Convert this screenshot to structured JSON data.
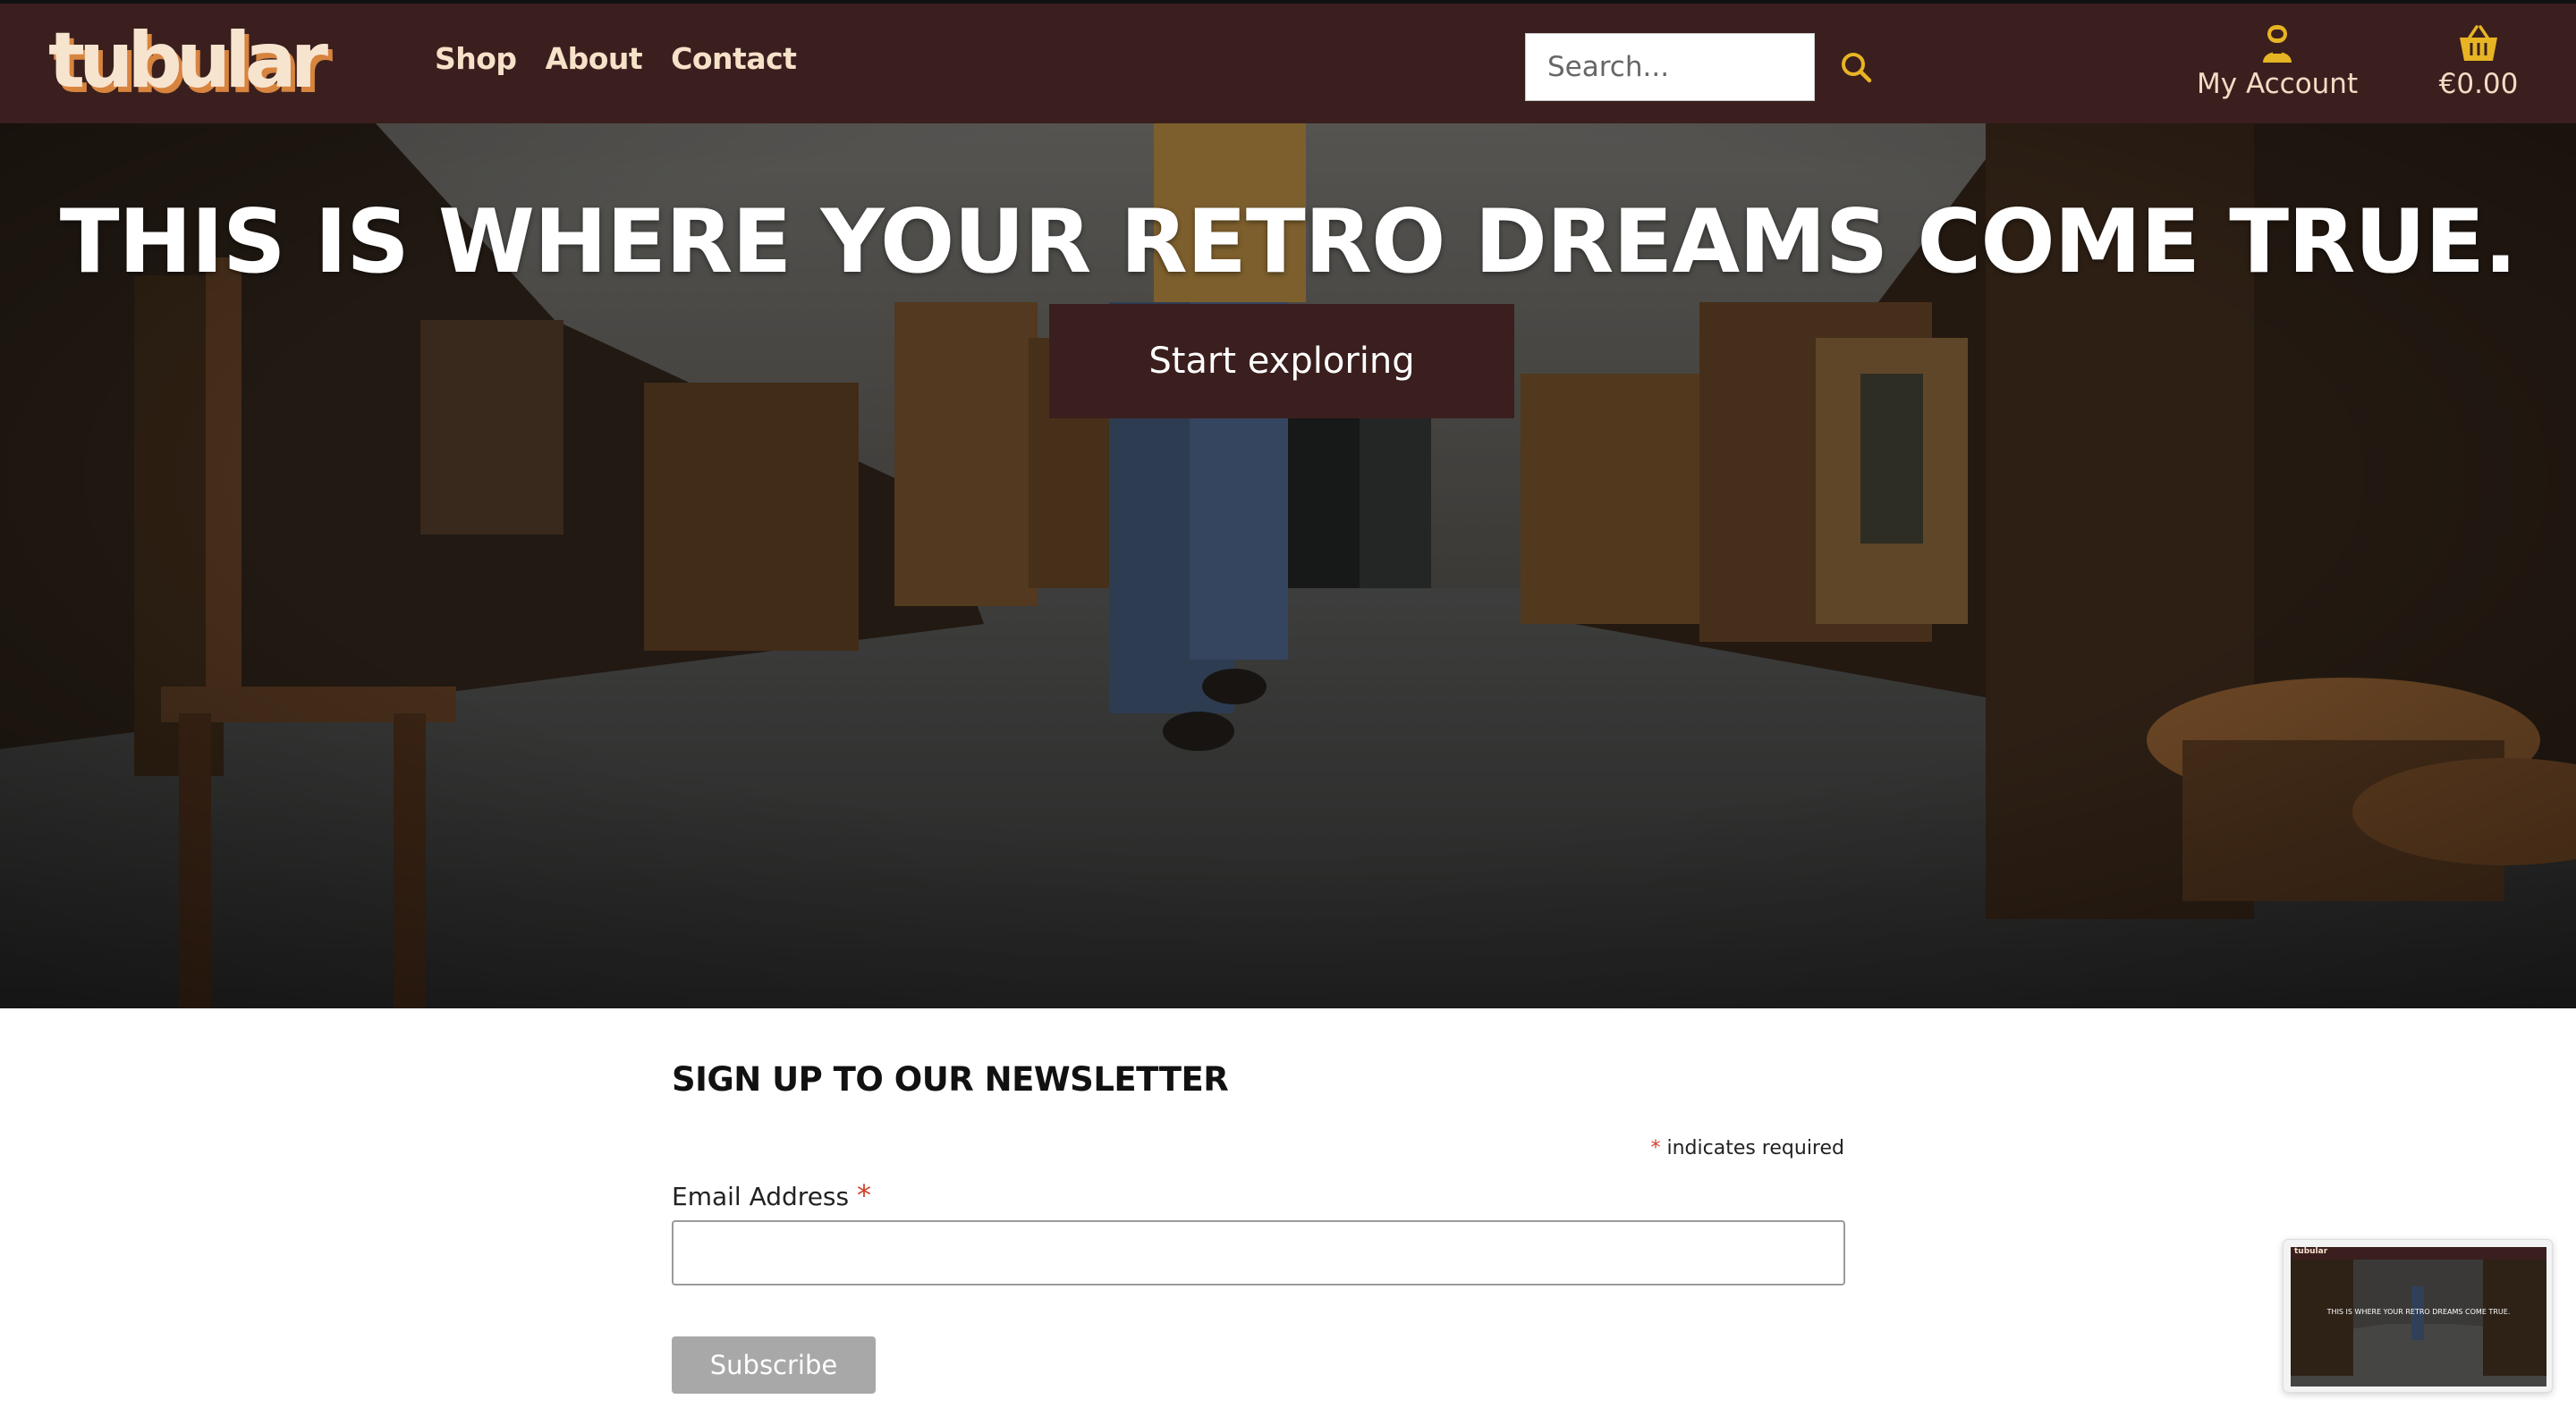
{
  "header": {
    "logo_text": "tubular",
    "nav": [
      {
        "label": "Shop"
      },
      {
        "label": "About"
      },
      {
        "label": "Contact"
      }
    ],
    "search": {
      "placeholder": "Search...",
      "icon": "search-icon"
    },
    "account": {
      "label": "My Account",
      "icon": "user-icon"
    },
    "cart": {
      "label": "€0.00",
      "icon": "basket-icon"
    },
    "colors": {
      "background": "#3a1f1e",
      "text": "#f6e1c9",
      "icon": "#e7b424"
    }
  },
  "hero": {
    "title": "THIS IS WHERE YOUR RETRO DREAMS COME TRUE.",
    "cta_label": "Start exploring"
  },
  "newsletter": {
    "title": "SIGN UP TO OUR NEWSLETTER",
    "required_note": "indicates required",
    "required_mark": "*",
    "email_label": "Email Address",
    "email_value": "",
    "subscribe_label": "Subscribe"
  },
  "thumbnail": {
    "logo_text": "tubular",
    "title": "THIS IS WHERE YOUR RETRO DREAMS COME TRUE."
  }
}
